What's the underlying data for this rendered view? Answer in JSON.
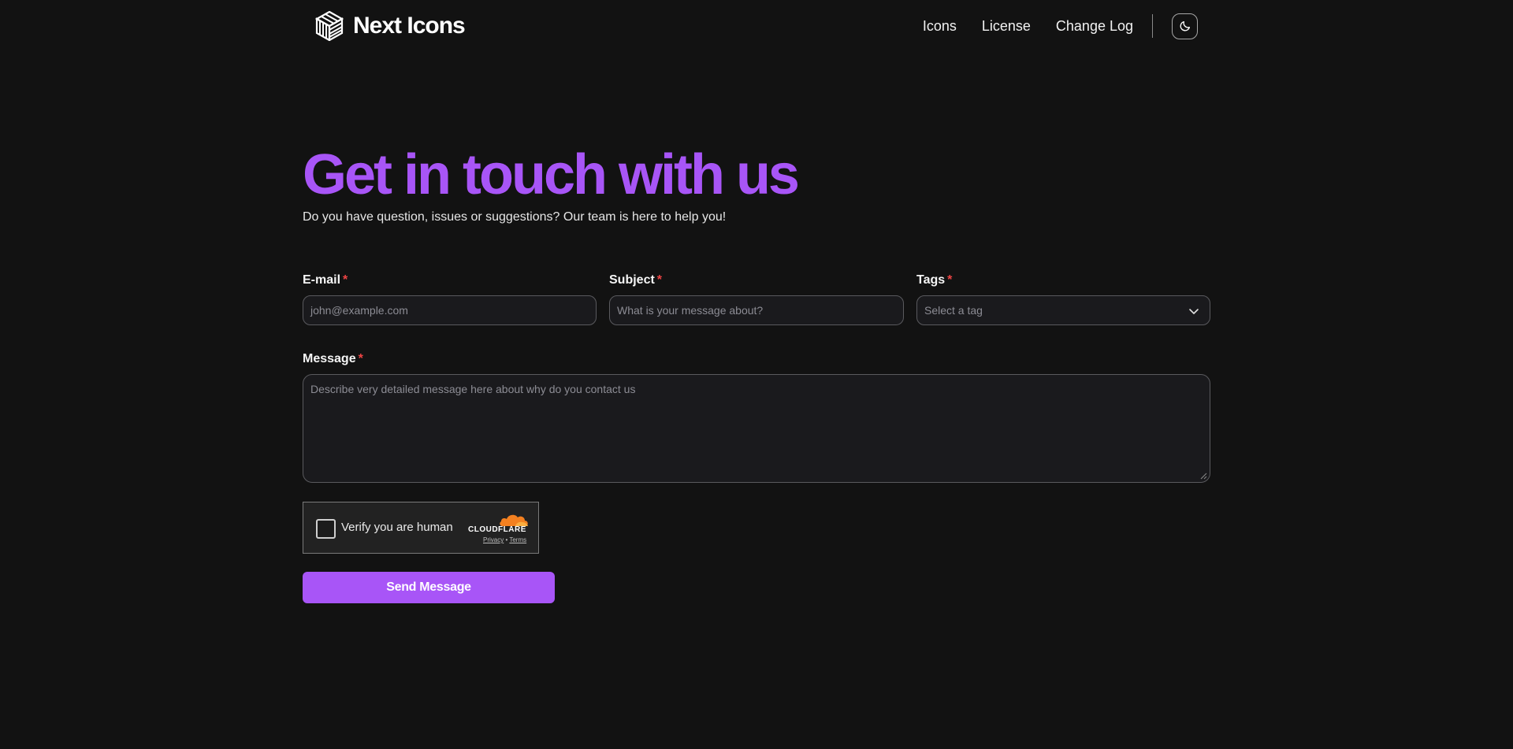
{
  "brand": {
    "name": "Next Icons",
    "logo_icon": "cube-logo-icon"
  },
  "nav": {
    "items": [
      {
        "label": "Icons"
      },
      {
        "label": "License"
      },
      {
        "label": "Change Log"
      }
    ],
    "theme_toggle_icon": "moon-icon"
  },
  "hero": {
    "title": "Get in touch with us",
    "subtitle": "Do you have question, issues or suggestions? Our team is here to help you!"
  },
  "form": {
    "email": {
      "label": "E-mail",
      "required_mark": "*",
      "placeholder": "john@example.com",
      "value": ""
    },
    "subject": {
      "label": "Subject",
      "required_mark": "*",
      "placeholder": "What is your message about?",
      "value": ""
    },
    "tags": {
      "label": "Tags",
      "required_mark": "*",
      "selected": "Select a tag",
      "icon": "chevron-down-icon"
    },
    "message": {
      "label": "Message",
      "required_mark": "*",
      "placeholder": "Describe very detailed message here about why do you contact us",
      "value": ""
    },
    "submit_label": "Send Message"
  },
  "captcha": {
    "label": "Verify you are human",
    "brand": "CLOUDFLARE",
    "privacy": "Privacy",
    "separator": "•",
    "terms": "Terms"
  },
  "colors": {
    "accent": "#a855f7",
    "background": "#121212",
    "required": "#ef4444",
    "cloudflare_orange": "#f38020"
  }
}
